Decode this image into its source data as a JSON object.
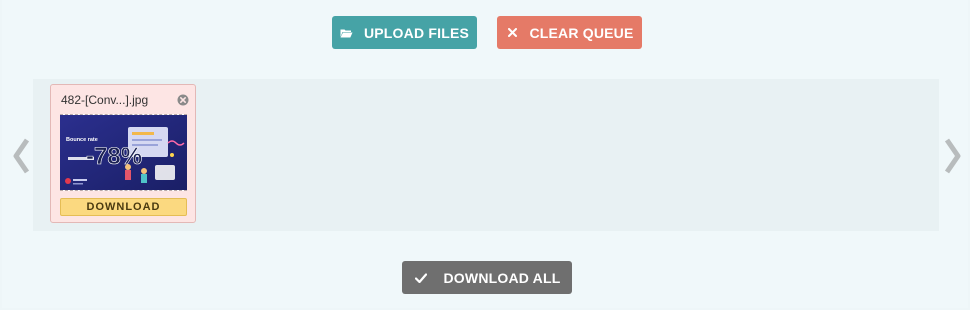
{
  "toolbar": {
    "upload_label": "UPLOAD FILES",
    "upload_icon": "folder-open-icon",
    "clear_label": "CLEAR QUEUE",
    "clear_icon": "close-icon"
  },
  "queue": {
    "nav_prev_icon": "chevron-left-icon",
    "nav_next_icon": "chevron-right-icon",
    "files": [
      {
        "name": "482-[Conv...].jpg",
        "download_label": "DOWNLOAD",
        "thumbnail": {
          "headline": "Bounce rate",
          "stat": "-78%"
        }
      }
    ]
  },
  "footer": {
    "download_all_label": "DOWNLOAD ALL",
    "download_all_icon": "check-icon"
  },
  "colors": {
    "upload": "#46a3a6",
    "clear": "#e57a67",
    "download_all": "#6f6f6f",
    "card_bg": "#fde5e4",
    "download_btn": "#fbd980"
  }
}
